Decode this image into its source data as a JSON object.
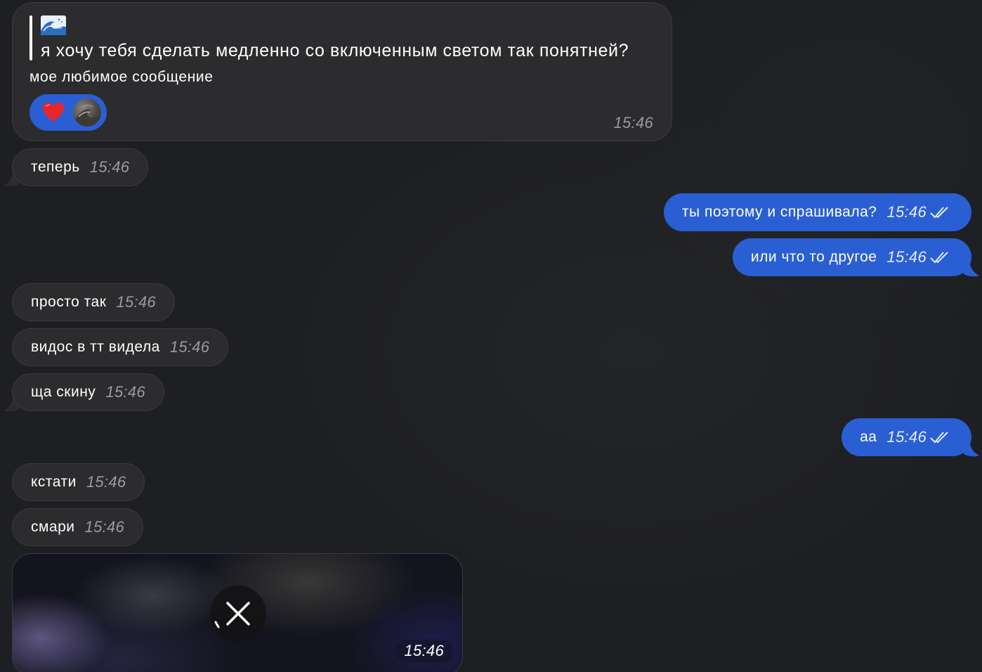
{
  "colors": {
    "background": "#1e1f22",
    "incoming_bubble": "#2c2c2e",
    "outgoing_bubble": "#2a5fd4",
    "timestamp_incoming": "#9a9aa0"
  },
  "quoted_message": {
    "quote_icon": "ocean-wave-emoji",
    "quote_text": "я хочу тебя сделать медленно со включенным светом так понятней?",
    "text": "мое любимое сообщение",
    "reaction_icon": "heart-icon",
    "time": "15:46"
  },
  "messages": [
    {
      "text": "теперь",
      "time": "15:46",
      "direction": "in"
    },
    {
      "text": "ты поэтому и спрашивала?",
      "time": "15:46",
      "direction": "out",
      "status": "read"
    },
    {
      "text": "или что то другое",
      "time": "15:46",
      "direction": "out",
      "status": "read"
    },
    {
      "text": "просто так",
      "time": "15:46",
      "direction": "in"
    },
    {
      "text": "видос в тт видела",
      "time": "15:46",
      "direction": "in"
    },
    {
      "text": "ща скину",
      "time": "15:46",
      "direction": "in"
    },
    {
      "text": "аа",
      "time": "15:46",
      "direction": "out",
      "status": "read"
    },
    {
      "text": "кстати",
      "time": "15:46",
      "direction": "in"
    },
    {
      "text": "смари",
      "time": "15:46",
      "direction": "in"
    }
  ],
  "media_message": {
    "status_icon": "cancel-download-icon",
    "time": "15:46"
  }
}
